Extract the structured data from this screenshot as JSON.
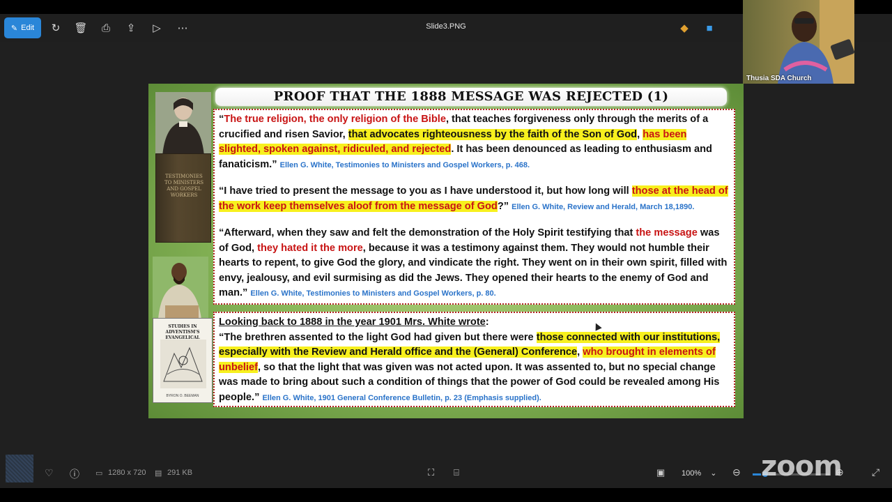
{
  "toolbar": {
    "edit_label": "Edit",
    "file_name": "Slide3.PNG"
  },
  "slide": {
    "title": "PROOF THAT THE 1888 MESSAGE WAS REJECTED (1)",
    "book1_cover": "TESTIMONIES TO MINISTERS AND GOSPEL WORKERS",
    "book2_cover": "STUDIES IN ADVENTISM'S EVANGELICAL GOSPEL",
    "book2_author": "BYRON O. BEEMAN",
    "q1": {
      "open": "“",
      "red1": "The true religion, the only religion of the Bible",
      "t1": ", that teaches forgiveness only through the merits of a crucified and risen Savior, ",
      "hl1": "that advocates righteousness by the faith of the Son of God",
      "t2": ", ",
      "hlred1": "has been slighted, spoken against, ridiculed, and rejected",
      "t3": ". It has been denounced as leading to enthusiasm and fanaticism.”",
      "src": "Ellen G. White, Testimonies to Ministers and Gospel Workers, p. 468."
    },
    "q2": {
      "t1": "“I have tried to present the message to you as I have understood it, but how long will ",
      "hlred1": "those at the head of the work keep themselves aloof from the message of God",
      "t2": "?”",
      "src": "Ellen G. White, Review and Herald, March 18,1890."
    },
    "q3": {
      "t1": "“Afterward, when they saw and felt the demonstration of the Holy Spirit testifying that ",
      "red1": "the message",
      "t2": " was of God, ",
      "red2": "they hated it the more",
      "t3": ", because it was a testimony against them. They would not humble their hearts to repent, to give God the glory, and vindicate the right. They went on in their own spirit, filled with envy, jealousy, and evil surmising as did the Jews. They opened their hearts to the enemy of God and man.”",
      "src": "Ellen G. White, Testimonies to Ministers and Gospel Workers, p. 80."
    },
    "q4": {
      "heading": "Looking back to 1888 in the year 1901 Mrs. White wrote",
      "colon": ":",
      "t1": "“The brethren assented to the light God had given but there were ",
      "hl1": "those connected with our institutions, especially with the Review and Herald office and the (General) Conference",
      "t2": ", ",
      "hlred1": "who brought in elements of unbelief",
      "t3": ", so that the light that was given was not acted upon. It was assented to, but no special change was made to bring about such a condition of things that the power of God could be revealed among His people.”",
      "src": "Ellen G. White, 1901 General Conference Bulletin, p. 23 (Emphasis supplied)."
    }
  },
  "statusbar": {
    "dimensions": "1280 x 720",
    "file_size": "291 KB",
    "zoom": "100%"
  },
  "video": {
    "participant": "Thusia SDA Church",
    "brand": "zoom"
  }
}
